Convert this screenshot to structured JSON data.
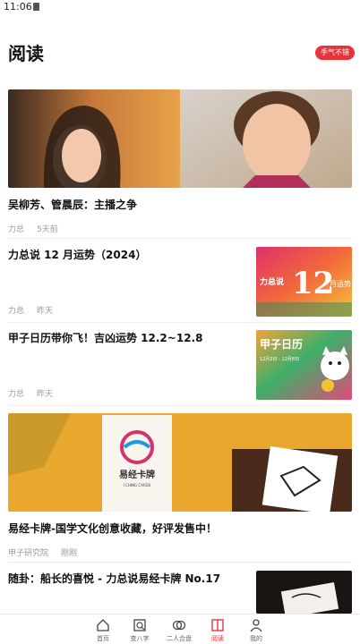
{
  "status_bar": {
    "time": "11:06"
  },
  "header": {
    "title": "阅读",
    "badge": "手气不错"
  },
  "articles": [
    {
      "title": "吴柳芳、管晨辰：主播之争",
      "author": "力总",
      "time": "5天前"
    },
    {
      "title": "力总说 12 月运势（2024）",
      "author": "力总",
      "time": "昨天",
      "thumb_text": {
        "brand": "力总说",
        "number": "12",
        "suffix": "月运势"
      }
    },
    {
      "title": "甲子日历带你飞！吉凶运势 12.2~12.8",
      "author": "力总",
      "time": "昨天",
      "thumb_text": {
        "brand": "甲子日历",
        "range": "12月2日 - 12月8日"
      }
    },
    {
      "title": "易经卡牌-国学文化创意收藏，好评发售中！",
      "author": "甲子研究院",
      "time": "刚刚",
      "card_text": {
        "title": "易经卡牌",
        "subtitle": "I CHING CARDS"
      }
    },
    {
      "title": "随卦：船长的喜悦 - 力总说易经卡牌 No.17",
      "author": "",
      "time": ""
    }
  ],
  "tabbar": {
    "items": [
      {
        "label": "首页",
        "icon": "home-icon"
      },
      {
        "label": "查八字",
        "icon": "search-doc-icon"
      },
      {
        "label": "二人合盘",
        "icon": "rings-icon"
      },
      {
        "label": "阅读",
        "icon": "book-icon"
      },
      {
        "label": "我的",
        "icon": "person-icon"
      }
    ],
    "active": "阅读",
    "accent": "#e8333a"
  }
}
